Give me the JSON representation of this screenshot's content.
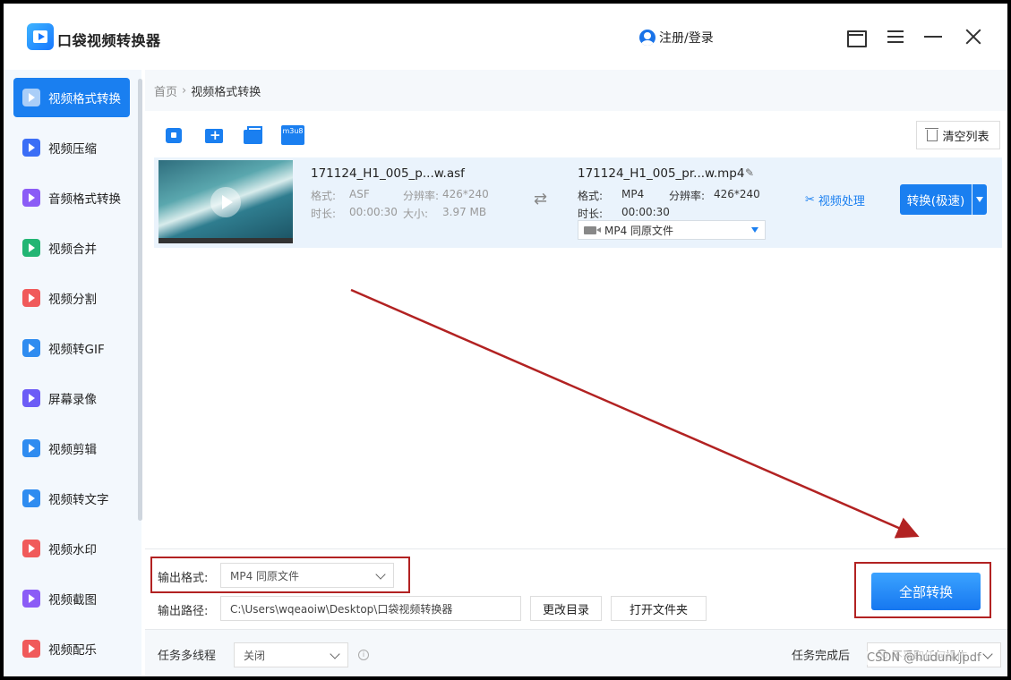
{
  "app": {
    "title": "口袋视频转换器",
    "login_label": "注册/登录"
  },
  "sidebar": {
    "items": [
      {
        "label": "视频格式转换",
        "icon": "video-convert-icon",
        "color": "#1a7ff0",
        "active": true
      },
      {
        "label": "视频压缩",
        "icon": "video-compress-icon",
        "color": "#3b6ef6"
      },
      {
        "label": "音频格式转换",
        "icon": "audio-convert-icon",
        "color": "#8b5cf6"
      },
      {
        "label": "视频合并",
        "icon": "video-merge-icon",
        "color": "#22b573"
      },
      {
        "label": "视频分割",
        "icon": "video-split-icon",
        "color": "#f05a5a"
      },
      {
        "label": "视频转GIF",
        "icon": "video-gif-icon",
        "color": "#2f8cf0"
      },
      {
        "label": "屏幕录像",
        "icon": "screen-record-icon",
        "color": "#6c5cf6"
      },
      {
        "label": "视频剪辑",
        "icon": "video-edit-icon",
        "color": "#2f8cf0"
      },
      {
        "label": "视频转文字",
        "icon": "video-text-icon",
        "color": "#2f8cf0"
      },
      {
        "label": "视频水印",
        "icon": "video-watermark-icon",
        "color": "#f05a5a"
      },
      {
        "label": "视频截图",
        "icon": "video-screenshot-icon",
        "color": "#8b5cf6"
      },
      {
        "label": "视频配乐",
        "icon": "video-music-icon",
        "color": "#f05a5a"
      }
    ]
  },
  "breadcrumb": {
    "home": "首页",
    "separator": "›",
    "current": "视频格式转换"
  },
  "toolbar": {
    "m3u8_label": "m3u8",
    "clear_label": "清空列表"
  },
  "file": {
    "source_name": "171124_H1_005_p...w.asf",
    "format_label": "格式:",
    "source_format": "ASF",
    "resolution_label": "分辨率:",
    "source_resolution": "426*240",
    "duration_label": "时长:",
    "source_duration": "00:00:30",
    "size_label": "大小:",
    "source_size": "3.97 MB",
    "convert_arrow": "⇄",
    "output_name": "171124_H1_005_pr...w.mp4",
    "output_format": "MP4",
    "output_resolution": "426*240",
    "output_duration": "00:00:30",
    "output_select": "MP4   同原文件",
    "process_label": "视频处理",
    "convert_label": "转换(极速)"
  },
  "bottom": {
    "output_format_label": "输出格式:",
    "output_format_value": "MP4   同原文件",
    "output_path_label": "输出路径:",
    "output_path_value": "C:\\Users\\wqeaoiw\\Desktop\\口袋视频转换器",
    "change_dir_label": "更改目录",
    "open_folder_label": "打开文件夹",
    "convert_all_label": "全部转换"
  },
  "footer": {
    "multithread_label": "任务多线程",
    "multithread_value": "关闭",
    "after_task_label": "任务完成后",
    "after_task_value": "不采取任何操作"
  },
  "watermark": "CSDN @hudunkjpdf",
  "colors": {
    "accent": "#1a7ff0",
    "annotation": "#b22222"
  }
}
